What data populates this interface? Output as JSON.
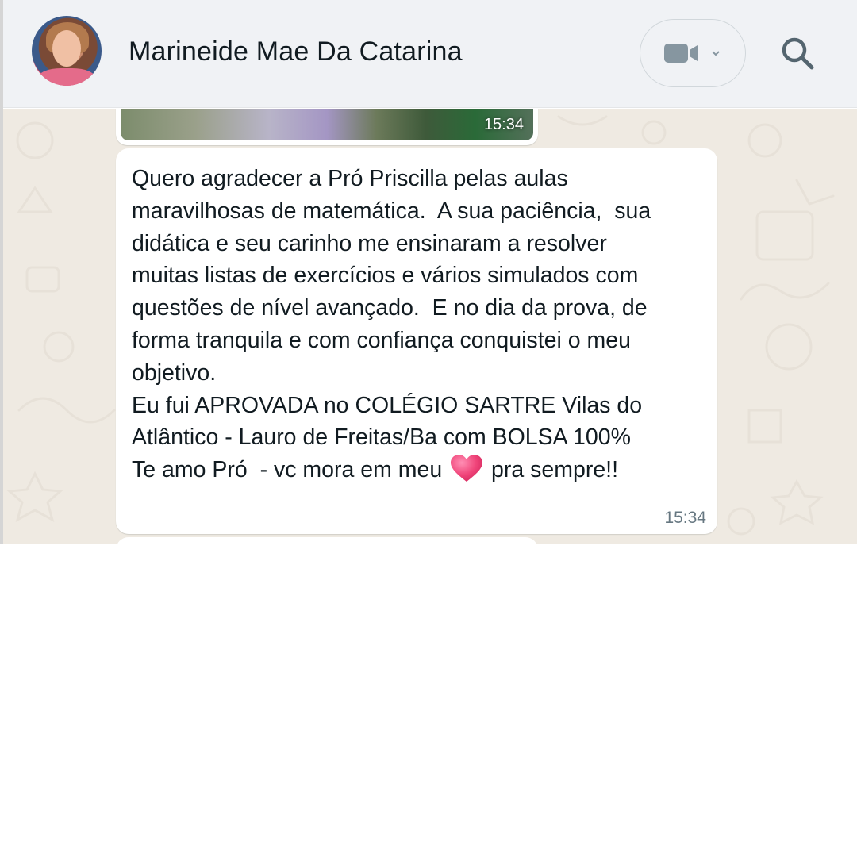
{
  "header": {
    "contact_name": "Marineide Mae Da Catarina",
    "avatar_icon": "contact-avatar",
    "video_call_icon": "video-camera-icon",
    "video_menu_icon": "chevron-down-icon",
    "search_icon": "search-icon"
  },
  "messages": [
    {
      "type": "image",
      "time": "15:34"
    },
    {
      "type": "text",
      "text_before_emoji": "Quero agradecer a Pró Priscilla pelas aulas\nmaravilhosas de matemática.  A sua paciência,  sua\ndidática e seu carinho me ensinaram a resolver\nmuitas listas de exercícios e vários simulados com\nquestões de nível avançado.  E no dia da prova, de\nforma tranquila e com confiança conquistei o meu\nobjetivo.\nEu fui APROVADA no COLÉGIO SARTRE Vilas do\nAtlântico - Lauro de Freitas/Ba com BOLSA 100%\nTe amo Pró  - vc mora em meu ",
      "emoji": "heart-icon",
      "text_after_emoji": " pra sempre!!",
      "time": "15:34"
    }
  ],
  "colors": {
    "header_bg": "#f0f2f5",
    "chat_bg": "#efeae2",
    "bubble_bg": "#ffffff",
    "text": "#111b21",
    "meta_text": "#667781",
    "heart": "#f0457a"
  }
}
